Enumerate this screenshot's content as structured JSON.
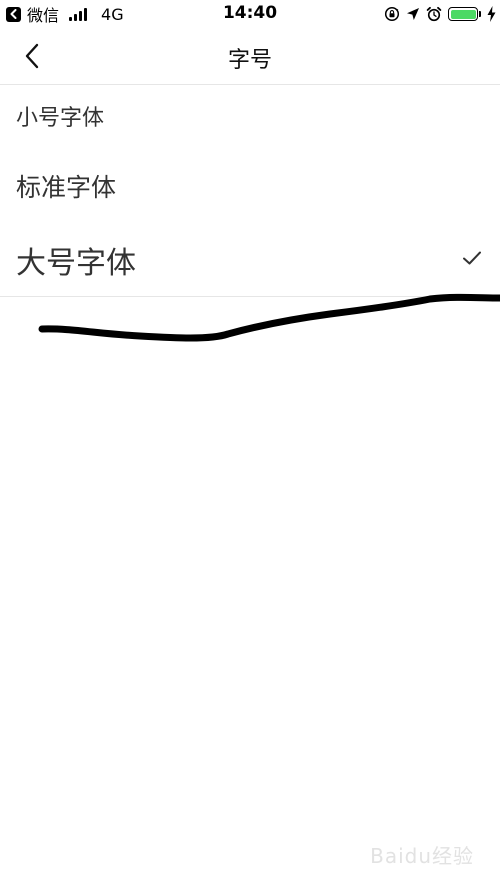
{
  "status_bar": {
    "back_app": "微信",
    "network": "4G",
    "time": "14:40",
    "battery_color": "#4cd964",
    "icons": [
      "back-arrow-icon",
      "signal-icon",
      "rotation-lock-icon",
      "location-icon",
      "alarm-icon",
      "battery-icon",
      "charging-icon"
    ]
  },
  "nav": {
    "title": "字号",
    "back_icon": "chevron-left-icon"
  },
  "font_options": [
    {
      "label": "小号字体",
      "selected": false
    },
    {
      "label": "标准字体",
      "selected": false
    },
    {
      "label": "大号字体",
      "selected": true
    }
  ],
  "selected_icon": "checkmark-icon",
  "annotation": "hand-drawn-underline-stroke",
  "watermark": "Baidu经验"
}
